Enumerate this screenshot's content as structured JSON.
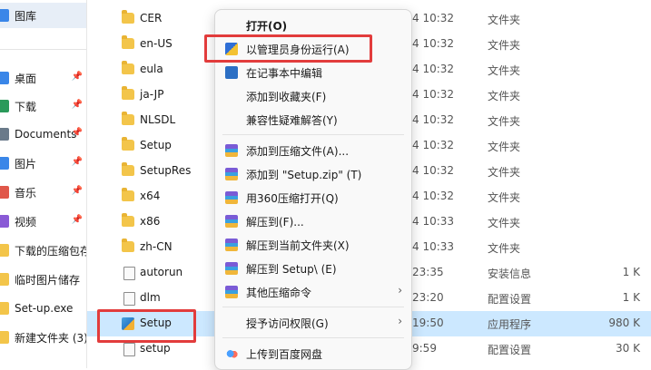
{
  "sidebar": {
    "items": [
      {
        "label": "图库",
        "icon": "gallery-icon",
        "color": "#3a86e8",
        "pinned": false,
        "selected": true
      },
      {
        "label": "桌面",
        "icon": "desktop-icon",
        "color": "#3a86e8",
        "pinned": true
      },
      {
        "label": "下载",
        "icon": "download-icon",
        "color": "#2a9a5a",
        "pinned": true
      },
      {
        "label": "Documents",
        "icon": "documents-icon",
        "color": "#6a7a8a",
        "pinned": true
      },
      {
        "label": "图片",
        "icon": "pictures-icon",
        "color": "#3a86e8",
        "pinned": true
      },
      {
        "label": "音乐",
        "icon": "music-icon",
        "color": "#e0574a",
        "pinned": true
      },
      {
        "label": "视频",
        "icon": "video-icon",
        "color": "#8a5ad6",
        "pinned": true
      },
      {
        "label": "下载的压缩包存",
        "icon": "folder-icon",
        "color": "#f3c54a",
        "pinned": false
      },
      {
        "label": "临时图片储存",
        "icon": "folder-icon",
        "color": "#f3c54a",
        "pinned": false
      },
      {
        "label": "Set-up.exe",
        "icon": "folder-icon",
        "color": "#f3c54a",
        "pinned": false
      },
      {
        "label": "新建文件夹 (3)",
        "icon": "folder-icon",
        "color": "#f3c54a",
        "pinned": false
      }
    ],
    "pin_glyph": "📌"
  },
  "files": [
    {
      "name": "CER",
      "date": "4 10:32",
      "type": "文件夹",
      "size": "",
      "icon": "folder"
    },
    {
      "name": "en-US",
      "date": "4 10:32",
      "type": "文件夹",
      "size": "",
      "icon": "folder"
    },
    {
      "name": "eula",
      "date": "4 10:32",
      "type": "文件夹",
      "size": "",
      "icon": "folder"
    },
    {
      "name": "ja-JP",
      "date": "4 10:32",
      "type": "文件夹",
      "size": "",
      "icon": "folder"
    },
    {
      "name": "NLSDL",
      "date": "4 10:32",
      "type": "文件夹",
      "size": "",
      "icon": "folder"
    },
    {
      "name": "Setup",
      "date": "4 10:32",
      "type": "文件夹",
      "size": "",
      "icon": "folder"
    },
    {
      "name": "SetupRes",
      "date": "4 10:32",
      "type": "文件夹",
      "size": "",
      "icon": "folder"
    },
    {
      "name": "x64",
      "date": "4 10:32",
      "type": "文件夹",
      "size": "",
      "icon": "folder"
    },
    {
      "name": "x86",
      "date": "4 10:33",
      "type": "文件夹",
      "size": "",
      "icon": "folder"
    },
    {
      "name": "zh-CN",
      "date": "4 10:33",
      "type": "文件夹",
      "size": "",
      "icon": "folder"
    },
    {
      "name": "autorun",
      "date": "23:35",
      "type": "安装信息",
      "size": "1 K",
      "icon": "config"
    },
    {
      "name": "dlm",
      "date": "23:20",
      "type": "配置设置",
      "size": "1 K",
      "icon": "config"
    },
    {
      "name": "Setup",
      "date": "19:50",
      "type": "应用程序",
      "size": "980 K",
      "icon": "app",
      "selected": true
    },
    {
      "name": "setup",
      "date": "9:59",
      "type": "配置设置",
      "size": "30 K",
      "icon": "config"
    }
  ],
  "context_menu": {
    "items": [
      {
        "label": "打开(O)",
        "bold": true,
        "icon": ""
      },
      {
        "label": "以管理员身份运行(A)",
        "icon": "shield"
      },
      {
        "label": "在记事本中编辑",
        "icon": "ie"
      },
      {
        "label": "添加到收藏夹(F)",
        "icon": ""
      },
      {
        "label": "兼容性疑难解答(Y)",
        "icon": ""
      },
      {
        "sep": true
      },
      {
        "label": "添加到压缩文件(A)...",
        "icon": "zip"
      },
      {
        "label": "添加到 \"Setup.zip\" (T)",
        "icon": "zip"
      },
      {
        "label": "用360压缩打开(Q)",
        "icon": "zip"
      },
      {
        "label": "解压到(F)...",
        "icon": "zip"
      },
      {
        "label": "解压到当前文件夹(X)",
        "icon": "zip"
      },
      {
        "label": "解压到 Setup\\ (E)",
        "icon": "zip"
      },
      {
        "label": "其他压缩命令",
        "icon": "zip",
        "submenu": true
      },
      {
        "sep": true
      },
      {
        "label": "授予访问权限(G)",
        "icon": "",
        "submenu": true
      },
      {
        "sep": true
      },
      {
        "label": "上传到百度网盘",
        "icon": "cloud"
      }
    ],
    "submenu_glyph": "›"
  },
  "colors": {
    "highlight": "#e23c3c",
    "selection": "#cce8ff"
  }
}
